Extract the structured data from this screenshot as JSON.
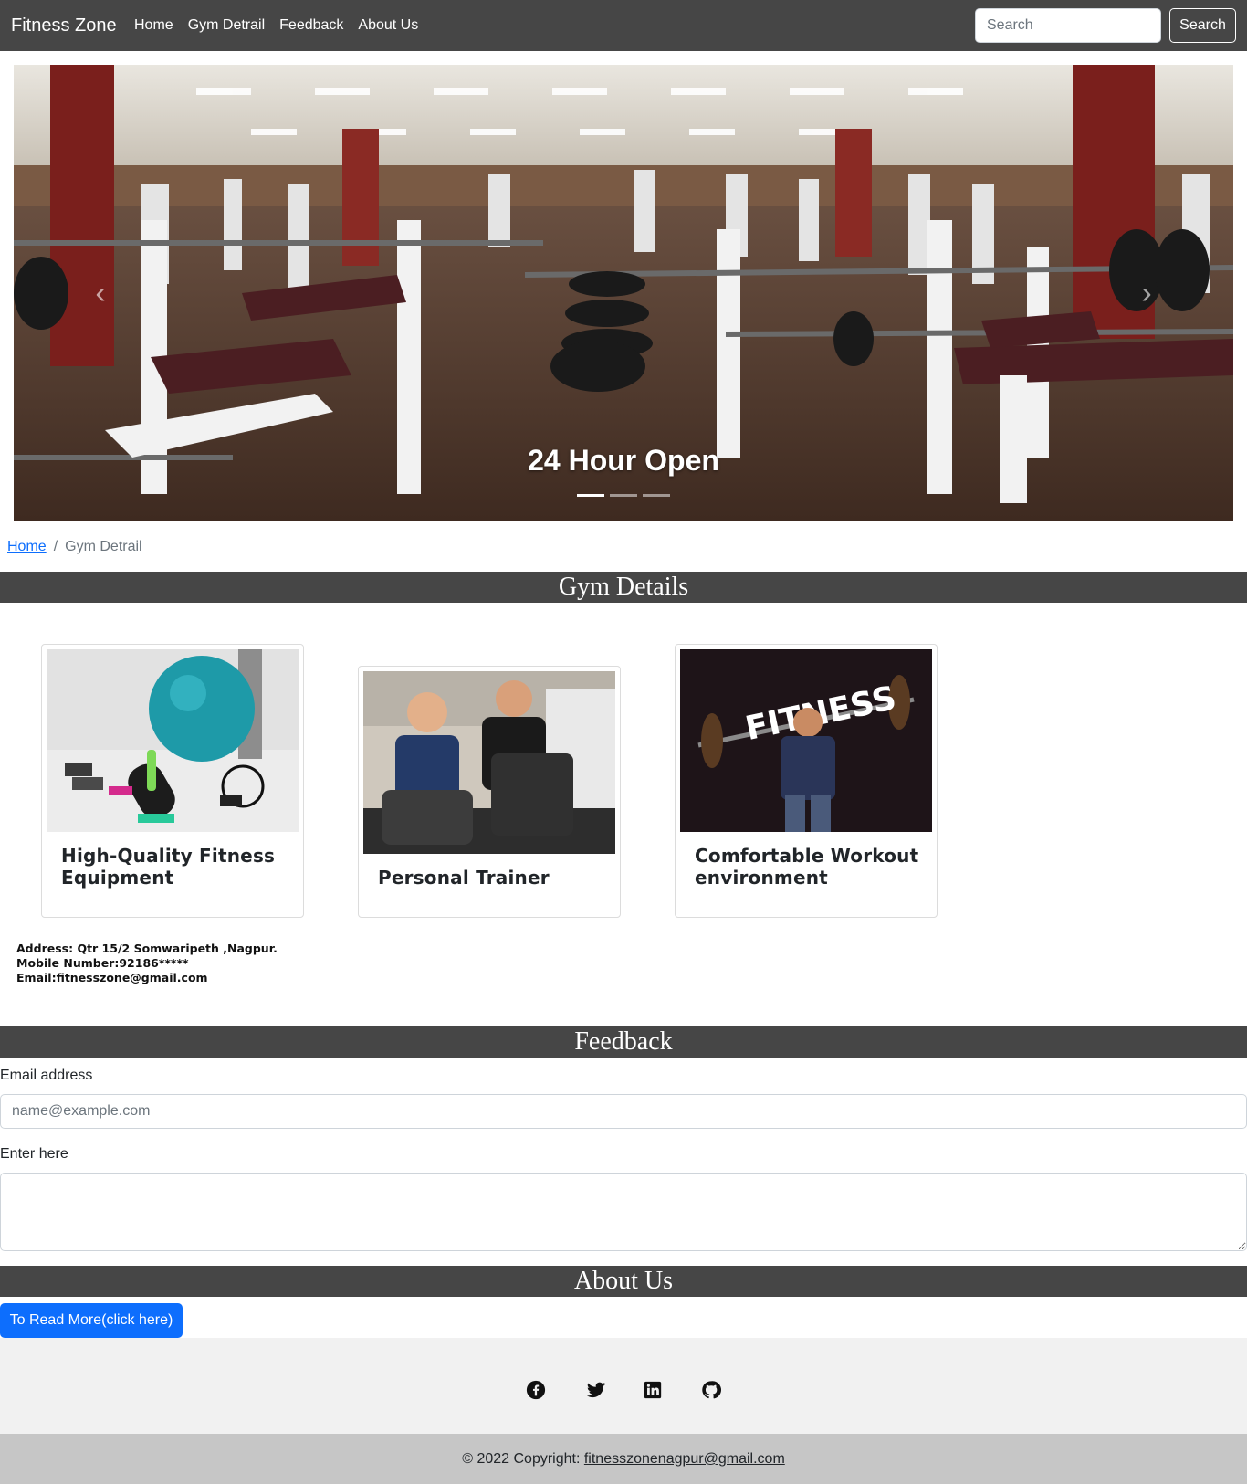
{
  "navbar": {
    "brand": "Fitness Zone",
    "links": [
      "Home",
      "Gym Detrail",
      "Feedback",
      "About Us"
    ],
    "search_placeholder": "Search",
    "search_button": "Search"
  },
  "carousel": {
    "caption": "24 Hour Open",
    "prev_glyph": "‹",
    "next_glyph": "›",
    "slide_count": 3,
    "active_slide": 1
  },
  "breadcrumb": {
    "home": "Home",
    "separator": "/",
    "current": "Gym Detrail"
  },
  "gym_details": {
    "heading": "Gym Details",
    "cards": [
      {
        "title": "High-Quality Fitness Equipment"
      },
      {
        "title": "Personal Trainer"
      },
      {
        "title": "Comfortable Workout environment",
        "image_text": "FITNESS"
      }
    ],
    "contact": {
      "address": "Address: Qtr 15/2 Somwaripeth ,Nagpur.",
      "mobile": "Mobile Number:92186*****",
      "email": "Email:fitnesszone@gmail.com"
    }
  },
  "feedback": {
    "heading": "Feedback",
    "email_label": "Email address",
    "email_placeholder": "name@example.com",
    "message_label": "Enter here"
  },
  "about": {
    "heading": "About Us",
    "button": "To Read More(click here)"
  },
  "footer": {
    "social_icons": [
      "facebook-icon",
      "twitter-icon",
      "linkedin-icon",
      "github-icon"
    ],
    "copyright_prefix": "© 2022 Copyright: ",
    "copyright_email": "fitnesszonenagpur@gmail.com"
  },
  "colors": {
    "navbar_bg": "#464646",
    "section_bar_bg": "#464646",
    "primary": "#0d6efd",
    "footer_social_bg": "#f1f1f1",
    "footer_copy_bg": "#c6c6c6"
  }
}
